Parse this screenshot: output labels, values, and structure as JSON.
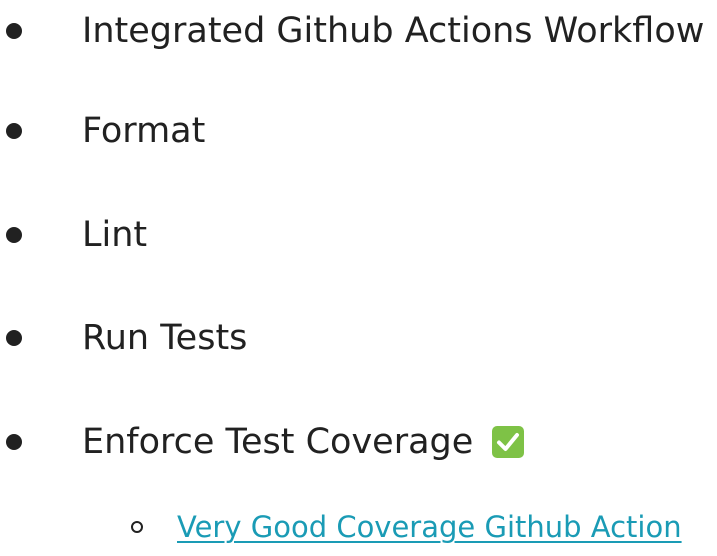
{
  "list": {
    "items": [
      {
        "label": "Integrated Github Actions Workflow"
      },
      {
        "label": "Format"
      },
      {
        "label": "Lint"
      },
      {
        "label": "Run Tests"
      },
      {
        "label": "Enforce Test Coverage",
        "icon": "check-mark-button-icon"
      }
    ],
    "subitems": [
      {
        "label": "Very Good Coverage Github Action"
      }
    ]
  },
  "colors": {
    "text": "#212121",
    "link": "#1a9bb5",
    "check_icon_bg": "#7ec246"
  }
}
